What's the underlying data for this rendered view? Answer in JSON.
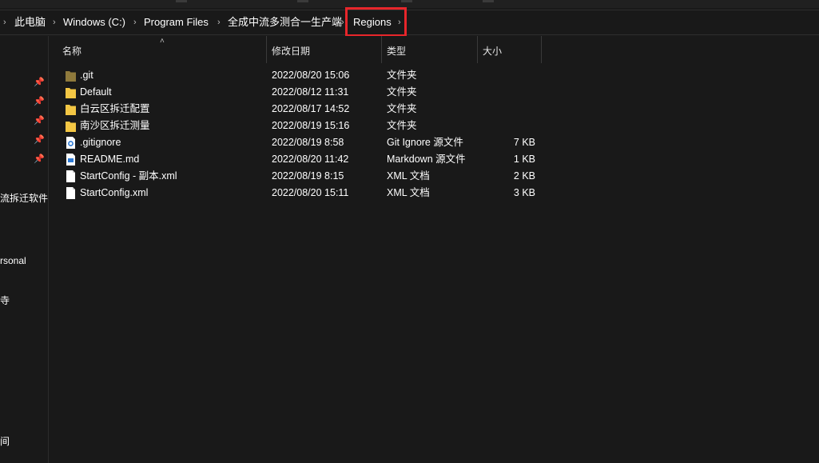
{
  "breadcrumb": {
    "items": [
      "此电脑",
      "Windows (C:)",
      "Program Files",
      "全成中流多测合一生产端",
      "Regions"
    ],
    "separator": "›"
  },
  "nav_pane": {
    "labels": [
      "流拆迁软件",
      "rsonal",
      "寺",
      "间"
    ]
  },
  "file_list": {
    "columns": {
      "name": "名称",
      "modified": "修改日期",
      "type": "类型",
      "size": "大小"
    },
    "rows": [
      {
        "name": ".git",
        "modified": "2022/08/20 15:06",
        "type": "文件夹",
        "size": "",
        "icon": "folder-dim-icon"
      },
      {
        "name": "Default",
        "modified": "2022/08/12 11:31",
        "type": "文件夹",
        "size": "",
        "icon": "folder-icon"
      },
      {
        "name": "白云区拆迁配置",
        "modified": "2022/08/17 14:52",
        "type": "文件夹",
        "size": "",
        "icon": "folder-icon"
      },
      {
        "name": "南沙区拆迁测量",
        "modified": "2022/08/19 15:16",
        "type": "文件夹",
        "size": "",
        "icon": "folder-icon"
      },
      {
        "name": ".gitignore",
        "modified": "2022/08/19 8:58",
        "type": "Git Ignore 源文件",
        "size": "7 KB",
        "icon": "gear-file-icon"
      },
      {
        "name": "README.md",
        "modified": "2022/08/20 11:42",
        "type": "Markdown 源文件",
        "size": "1 KB",
        "icon": "markdown-file-icon"
      },
      {
        "name": "StartConfig - 副本.xml",
        "modified": "2022/08/19 8:15",
        "type": "XML 文档",
        "size": "2 KB",
        "icon": "file-icon"
      },
      {
        "name": "StartConfig.xml",
        "modified": "2022/08/20 15:11",
        "type": "XML 文档",
        "size": "3 KB",
        "icon": "file-icon"
      }
    ]
  },
  "colors": {
    "background": "#191919",
    "highlight_box": "#e8262b",
    "folder": "#f3c744",
    "folder_dim": "#8f7a3c"
  }
}
